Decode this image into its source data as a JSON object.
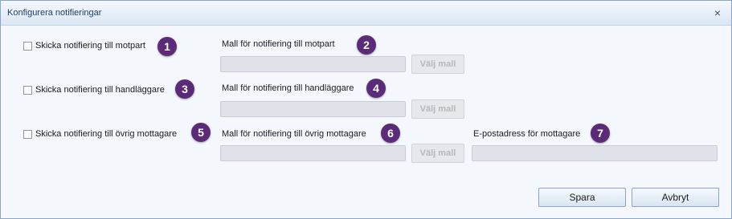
{
  "window": {
    "title": "Konfigurera notifieringar",
    "close_glyph": "×"
  },
  "rows": [
    {
      "checkbox_label": "Skicka notifiering till motpart",
      "template_label": "Mall för notifiering till motpart",
      "choose_button": "Välj mall",
      "badge_checkbox": "1",
      "badge_template": "2"
    },
    {
      "checkbox_label": "Skicka notifiering till handläggare",
      "template_label": "Mall för notifiering till handläggare",
      "choose_button": "Välj mall",
      "badge_checkbox": "3",
      "badge_template": "4"
    },
    {
      "checkbox_label": "Skicka notifiering till övrig mottagare",
      "template_label": "Mall för notifiering till övrig mottagare",
      "choose_button": "Välj mall",
      "badge_checkbox": "5",
      "badge_template": "6"
    }
  ],
  "email": {
    "label": "E-postadress för mottagare",
    "value": "",
    "badge": "7"
  },
  "footer": {
    "save_label": "Spara",
    "cancel_label": "Avbryt"
  },
  "colors": {
    "badge": "#5b2b7a",
    "title_text": "#1e3f74"
  }
}
